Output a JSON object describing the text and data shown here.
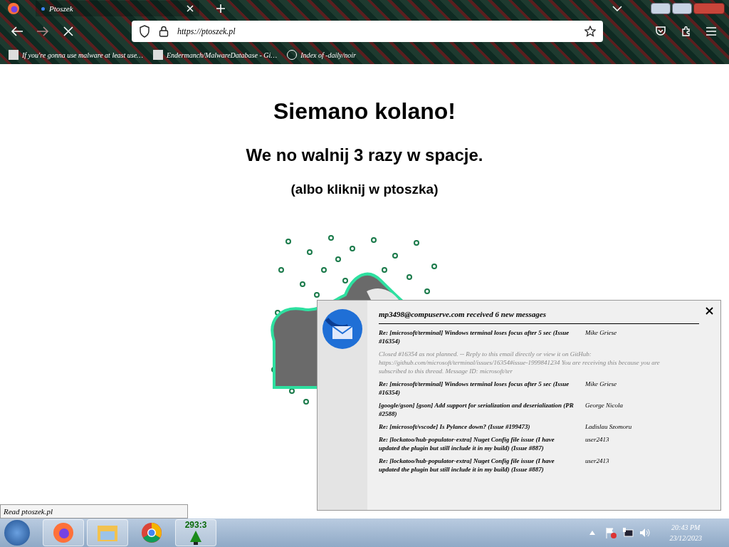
{
  "browser": {
    "tabs": [
      {
        "title": "Ptoszek",
        "selected": true
      }
    ],
    "url": "https://ptoszek.pl",
    "loading": true,
    "bookmarks": [
      {
        "label": "If you're gonna use malware at least use…"
      },
      {
        "label": "Endermanch/MalwareDatabase - Gi…"
      },
      {
        "label": "Index of -daily/noir"
      }
    ]
  },
  "page": {
    "heading": "Siemano kolano!",
    "subheading": "We no walnij 3 razy w spacje.",
    "hint": "(albo kliknij w ptoszka)"
  },
  "status_text": "Read ptoszek.pl",
  "notification": {
    "title": "mp3498@compuserve.com received 6 new messages",
    "messages": [
      {
        "subject": "Re: [microsoft/terminal] Windows terminal loses focus after 5 sec (Issue #16354)",
        "sender": "Mike Griese"
      },
      {
        "preview": "Closed #16354 as not planned. -- Reply to this email directly or view it on GitHub: https://github.com/microsoft/terminal/issues/16354#issue-1999841234 You are receiving this because you are subscribed to this thread. Message ID: microsoft/ter"
      },
      {
        "subject": "Re: [microsoft/terminal] Windows terminal loses focus after 5 sec (Issue #16354)",
        "sender": "Mike Griese"
      },
      {
        "subject": "[google/gson] [gson] Add support for serialization and deserialization (PR #2588)",
        "sender": "George Nicola"
      },
      {
        "subject": "Re: [microsoft/vscode] Is Pylance down? (Issue #199473)",
        "sender": "Ladislau Szomoru"
      },
      {
        "subject": "Re: [lockatoo/hub-populator-extra] Nuget Config file issue (I have updated the plugin but still include it in my build) (Issue #887)",
        "sender": "user2413"
      },
      {
        "subject": "Re: [lockatoo/hub-populator-extra] Nuget Config file issue (I have updated the plugin but still include it in my build) (Issue #887)",
        "sender": "user2413"
      }
    ]
  },
  "taskbar": {
    "counter": "293:3",
    "time": "20:43 PM",
    "date": "23/12/2023"
  }
}
